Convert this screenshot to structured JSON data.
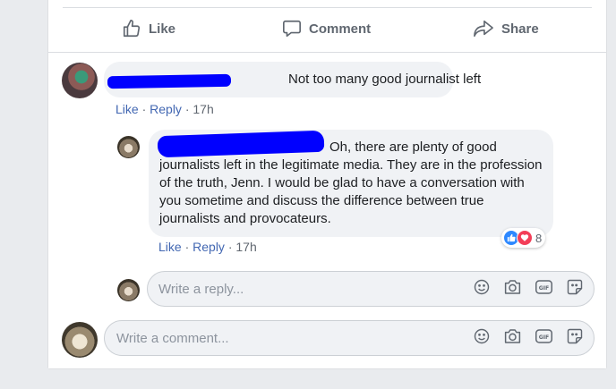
{
  "post_actions": {
    "like": "Like",
    "comment": "Comment",
    "share": "Share"
  },
  "comments": [
    {
      "text": "Not too many good journalist left",
      "actions": {
        "like": "Like",
        "reply": "Reply",
        "time": "17h"
      },
      "replies": [
        {
          "text": "Oh, there are plenty of good journalists left in the legitimate media. They are in the profession of the truth, Jenn. I would be glad to have a conversation with you sometime and discuss the difference between true journalists and provocateurs.",
          "actions": {
            "like": "Like",
            "reply": "Reply",
            "time": "17h"
          },
          "reactions": {
            "types": [
              "like",
              "love"
            ],
            "count": "8"
          }
        }
      ]
    }
  ],
  "reply_input": {
    "placeholder": "Write a reply..."
  },
  "comment_input": {
    "placeholder": "Write a comment..."
  },
  "input_icons": [
    "emoji-icon",
    "camera-icon",
    "gif-icon",
    "sticker-icon"
  ],
  "colors": {
    "link": "#4267b2",
    "like": "#2d88ff",
    "love": "#f33e58",
    "redaction": "#0000ff"
  }
}
